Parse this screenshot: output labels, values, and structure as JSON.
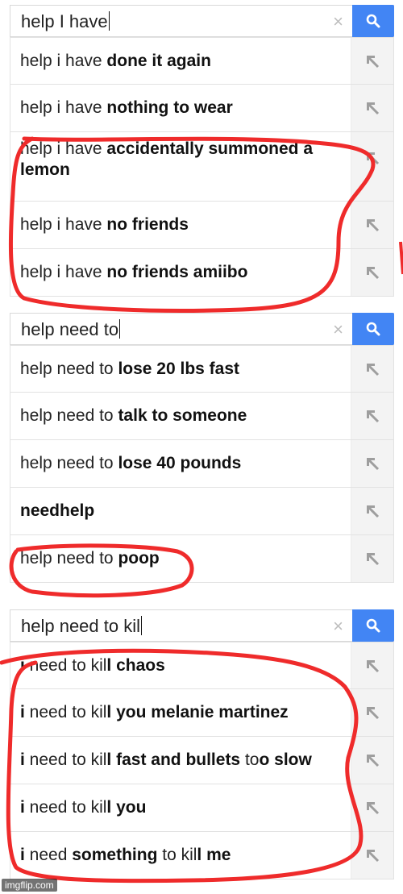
{
  "panels": [
    {
      "query": "help I have",
      "clear_glyph": "×",
      "suggestions": [
        {
          "pre": "help i have ",
          "bold": "done it again"
        },
        {
          "pre": "help i have ",
          "bold": "nothing to wear"
        },
        {
          "pre": "help i have ",
          "bold": "accidentally summoned a lemon"
        },
        {
          "pre": "help i have ",
          "bold": "no friends"
        },
        {
          "pre": "help i have ",
          "bold": "no friends amiibo"
        }
      ]
    },
    {
      "query": "help need to",
      "clear_glyph": "×",
      "suggestions": [
        {
          "pre": "help need to ",
          "bold": "lose 20 lbs fast"
        },
        {
          "pre": "help need to ",
          "bold": "talk to someone"
        },
        {
          "pre": "help need to ",
          "bold": "lose 40 pounds"
        },
        {
          "pre": "",
          "bold": "needhelp"
        },
        {
          "pre": "help need to ",
          "bold": "poop"
        }
      ]
    },
    {
      "query": "help need to kil",
      "clear_glyph": "×",
      "suggestions": [
        {
          "b1": "i",
          "t1": " need to kil",
          "b2": "l chaos"
        },
        {
          "b1": "i",
          "t1": " need to kil",
          "b2": "l you melanie martinez"
        },
        {
          "b1": "i",
          "t1": " need to kil",
          "b2": "l fast and bullets",
          "t2": " to",
          "b3": "o slow"
        },
        {
          "b1": "i",
          "t1": " need to kil",
          "b2": "l you"
        },
        {
          "b1": "i",
          "t1": " need ",
          "b2": "something",
          "t2": " to kil",
          "b3": "l me"
        }
      ]
    }
  ],
  "icons": {
    "search": "search-icon",
    "fill_query": "arrow-up-left-icon",
    "clear": "clear-icon"
  },
  "colors": {
    "search_button": "#4285f4",
    "annotation_red": "#ef2b2b"
  },
  "watermark": "imgflip.com"
}
